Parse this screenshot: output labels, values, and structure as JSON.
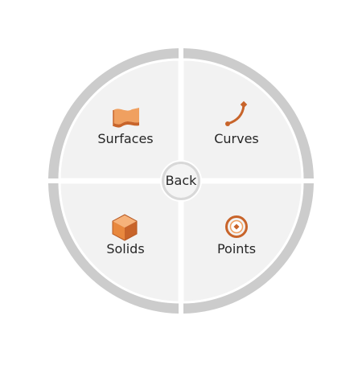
{
  "menu": {
    "center_label": "Back",
    "items": [
      {
        "label": "Surfaces",
        "icon": "surface-icon"
      },
      {
        "label": "Curves",
        "icon": "curve-icon"
      },
      {
        "label": "Solids",
        "icon": "solid-cube-icon"
      },
      {
        "label": "Points",
        "icon": "point-icon"
      }
    ]
  },
  "colors": {
    "ring": "#cccccc",
    "quadrant": "#f2f2f2",
    "accent": "#c8642a",
    "accent_light": "#f0a060",
    "text": "#262626"
  }
}
